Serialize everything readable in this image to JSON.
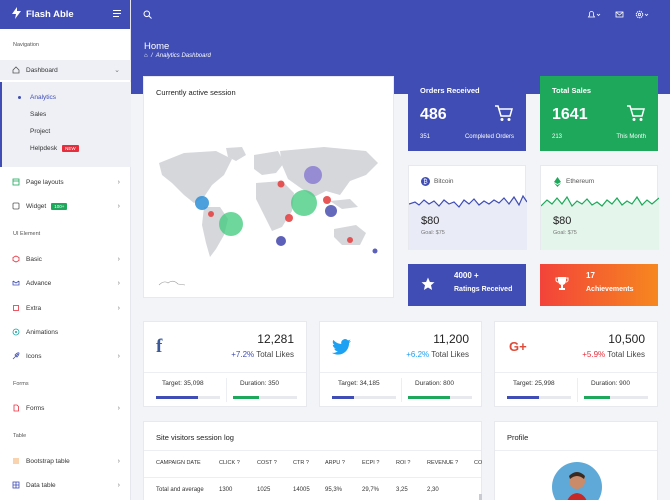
{
  "brand": {
    "name": "Flash Able"
  },
  "sidebar": {
    "caption_navigation": "Navigation",
    "caption_ui": "UI Element",
    "caption_forms": "Forms",
    "caption_table": "Table",
    "dashboard": "Dashboard",
    "sub": [
      "Analytics",
      "Sales",
      "Project",
      "Helpdesk"
    ],
    "helpdesk_badge": "NEW",
    "page_layouts": "Page layouts",
    "widget": "Widget",
    "widget_badge": "100+",
    "basic": "Basic",
    "advance": "Advance",
    "extra": "Extra",
    "animations": "Animations",
    "icons": "Icons",
    "forms": "Forms",
    "bootstrap_table": "Bootstrap table",
    "data_table": "Data table"
  },
  "header": {
    "title": "Home",
    "breadcrumb": "Analytics Dashboard"
  },
  "session_card": {
    "title": "Currently active session"
  },
  "orders": {
    "title": "Orders Received",
    "value": "486",
    "sub_left": "351",
    "sub_right": "Completed Orders"
  },
  "sales": {
    "title": "Total Sales",
    "value": "1641",
    "sub_left": "213",
    "sub_right": "This Month"
  },
  "bitcoin": {
    "name": "Bitcoin",
    "value": "$80",
    "goal": "Goal: $75"
  },
  "ethereum": {
    "name": "Ethereum",
    "value": "$80",
    "goal": "Goal: $75"
  },
  "ratings": {
    "value": "4000 +",
    "label": "Ratings Received"
  },
  "achievements": {
    "value": "17",
    "label": "Achievements"
  },
  "social": [
    {
      "value": "12,281",
      "pct": "+7.2%",
      "pct_label": "Total Likes",
      "target": "Target: 35,098",
      "duration": "Duration: 350",
      "target_fill": 0.65,
      "duration_fill": 0.4
    },
    {
      "value": "11,200",
      "pct": "+6.2%",
      "pct_label": "Total Likes",
      "target": "Target: 34,185",
      "duration": "Duration: 800",
      "target_fill": 0.35,
      "duration_fill": 0.65
    },
    {
      "value": "10,500",
      "pct": "+5.9%",
      "pct_label": "Total Likes",
      "target": "Target: 25,998",
      "duration": "Duration: 900",
      "target_fill": 0.5,
      "duration_fill": 0.4
    }
  ],
  "colors": {
    "primary": "#3f4db5",
    "green": "#1da85b",
    "orange": "#f05a28",
    "facebook": "#3b5998",
    "twitter": "#1da1f2",
    "google": "#dd4b39"
  },
  "log": {
    "title": "Site visitors session log",
    "headers": [
      "CAMPAIGN DATE",
      "CLICK",
      "COST",
      "CTR",
      "ARPU",
      "ECPI",
      "ROI",
      "REVENUE",
      "CO"
    ],
    "row": [
      "Total and average",
      "1300",
      "1025",
      "14005",
      "95,3%",
      "29,7%",
      "3,25",
      "2,30"
    ]
  },
  "profile": {
    "title": "Profile"
  }
}
